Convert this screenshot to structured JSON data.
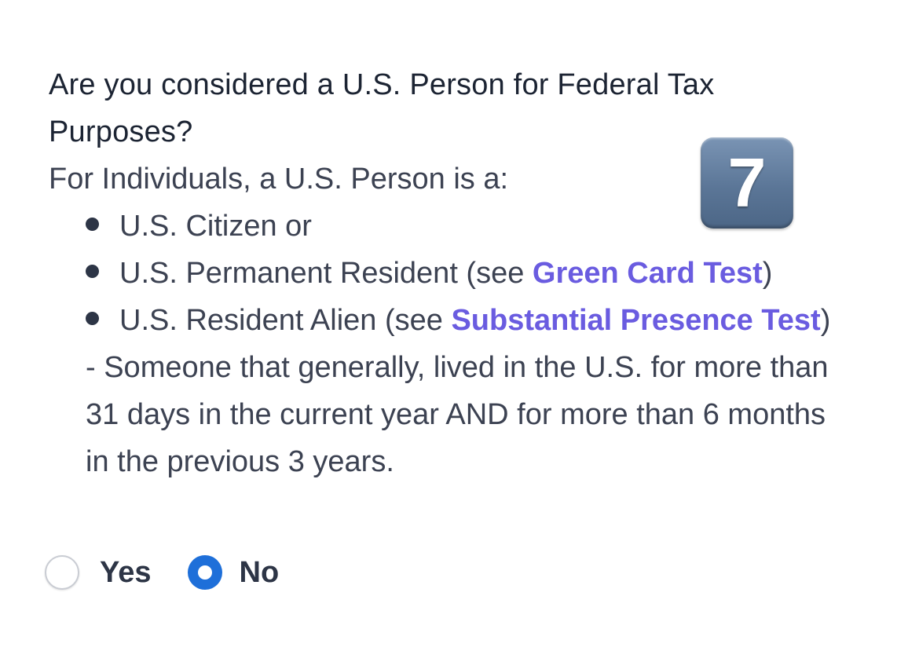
{
  "question": {
    "title": "Are you considered a U.S. Person for Federal Tax Purposes?",
    "intro": "For Individuals, a U.S. Person is a:",
    "bullets": [
      {
        "text": "U.S. Citizen or"
      },
      {
        "prefix": "U.S. Permanent Resident (see ",
        "link": "Green Card Test",
        "suffix": ")"
      },
      {
        "prefix": "U.S. Resident Alien (see ",
        "link": "Substantial Presence Test",
        "suffix": ") - Someone that generally, lived in the U.S. for more than 31 days in the current year AND for more than 6 months in the previous 3 years."
      }
    ]
  },
  "badge": {
    "label": "7",
    "icon": "keycap-7-emoji"
  },
  "answer": {
    "options": [
      {
        "label": "Yes",
        "selected": false
      },
      {
        "label": "No",
        "selected": true
      }
    ]
  },
  "colors": {
    "heading": "#1c2433",
    "body_text": "#3c4252",
    "link": "#6a5ce0",
    "radio_selected": "#1e6fd9",
    "radio_unselected_border": "#c9ccd3"
  }
}
